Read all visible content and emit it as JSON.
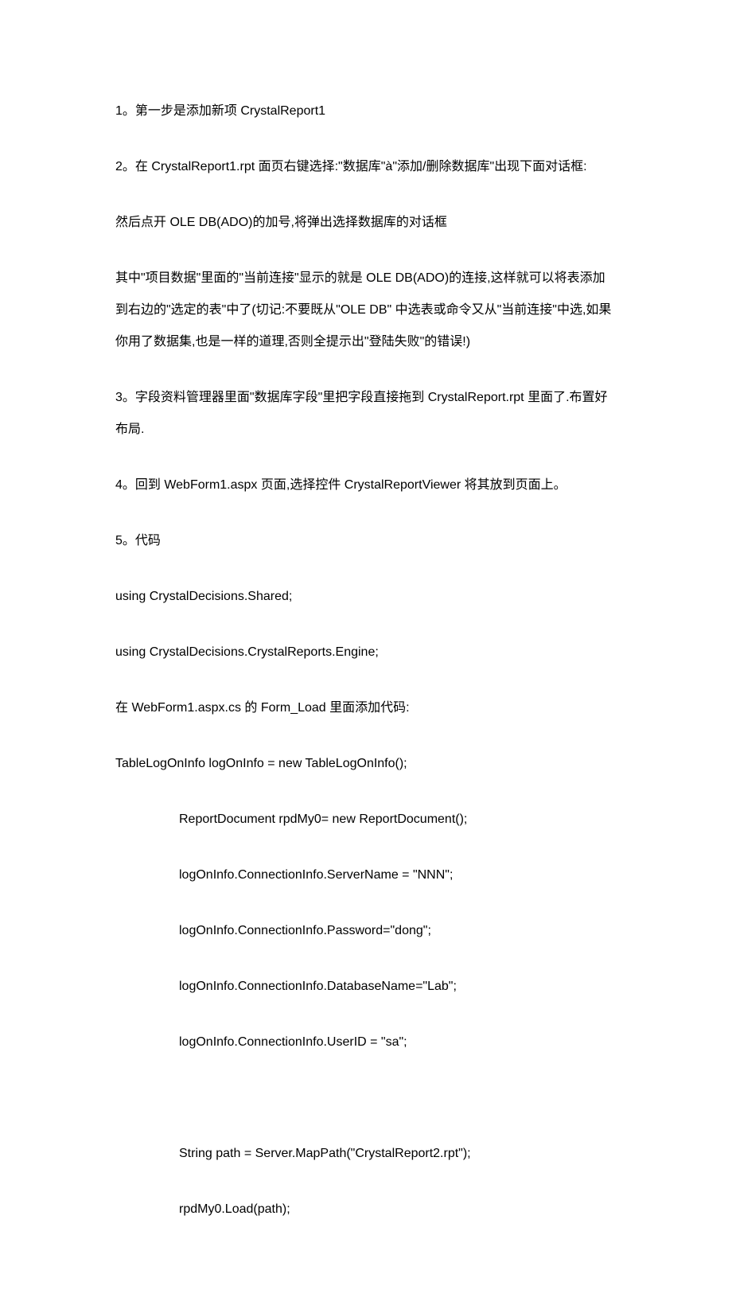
{
  "paragraphs": [
    {
      "text": "1。第一步是添加新项 CrystalReport1"
    },
    {
      "text": "2。在 CrystalReport1.rpt 面页右键选择:\"数据库\"à\"添加/删除数据库\"出现下面对话框:"
    },
    {
      "text": "然后点开 OLE DB(ADO)的加号,将弹出选择数据库的对话框"
    },
    {
      "text": "其中\"项目数据\"里面的\"当前连接\"显示的就是 OLE DB(ADO)的连接,这样就可以将表添加到右边的\"选定的表\"中了(切记:不要既从\"OLE DB\"  中选表或命令又从\"当前连接\"中选,如果你用了数据集,也是一样的道理,否则全提示出\"登陆失败\"的错误!)"
    },
    {
      "text": "3。字段资料管理器里面\"数据库字段\"里把字段直接拖到 CrystalReport.rpt 里面了.布置好布局."
    },
    {
      "text": "4。回到 WebForm1.aspx 页面,选择控件 CrystalReportViewer 将其放到页面上。"
    },
    {
      "text": "5。代码"
    },
    {
      "text": "using CrystalDecisions.Shared;"
    },
    {
      "text": "using CrystalDecisions.CrystalReports.Engine;"
    },
    {
      "text": "在 WebForm1.aspx.cs 的 Form_Load 里面添加代码:"
    },
    {
      "text": "TableLogOnInfo logOnInfo = new TableLogOnInfo();"
    },
    {
      "text": "ReportDocument rpdMy0= new ReportDocument();",
      "indent": true
    },
    {
      "text": "logOnInfo.ConnectionInfo.ServerName = \"NNN\";",
      "indent": true
    },
    {
      "text": "logOnInfo.ConnectionInfo.Password=\"dong\";",
      "indent": true
    },
    {
      "text": "logOnInfo.ConnectionInfo.DatabaseName=\"Lab\";",
      "indent": true
    },
    {
      "text": "logOnInfo.ConnectionInfo.UserID = \"sa\";",
      "indent": true
    },
    {
      "text": "",
      "blank": true
    },
    {
      "text": "String path = Server.MapPath(\"CrystalReport2.rpt\");",
      "indent": true
    },
    {
      "text": "rpdMy0.Load(path);",
      "indent": true
    }
  ]
}
